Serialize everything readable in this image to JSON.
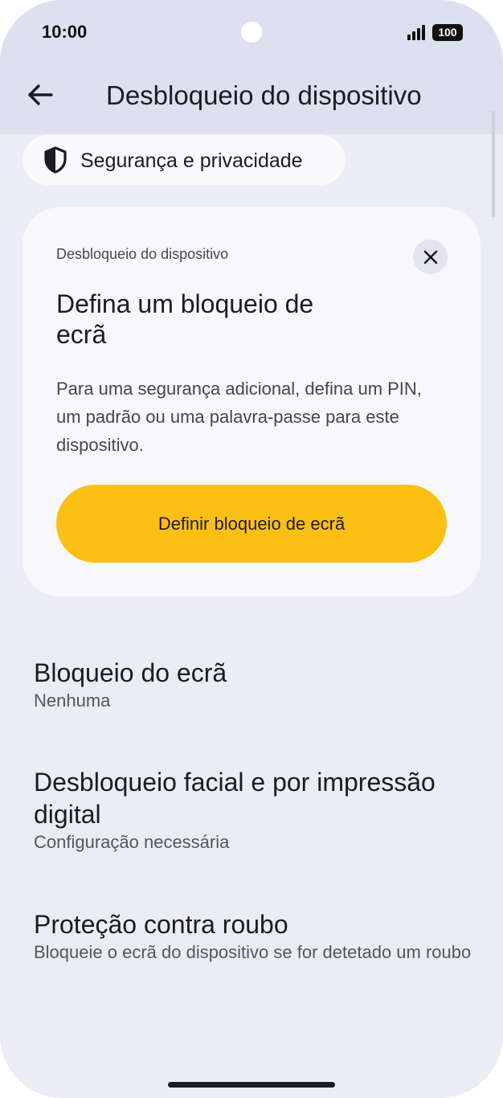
{
  "status_bar": {
    "time": "10:00",
    "battery": "100"
  },
  "app_bar": {
    "title": "Desbloqueio do dispositivo",
    "back_icon": "arrow-left-icon"
  },
  "breadcrumb_chip": {
    "label": "Segurança e privacidade",
    "icon": "shield-icon"
  },
  "card": {
    "overline": "Desbloqueio do dispositivo",
    "title": "Defina um bloqueio de ecrã",
    "description": "Para uma segurança adicional, defina um PIN, um padrão ou uma palavra-passe para este dispositivo.",
    "button_label": "Definir bloqueio de ecrã",
    "close_icon": "close-icon",
    "button_color": "#fcbf14"
  },
  "settings": [
    {
      "title": "Bloqueio do ecrã",
      "subtitle": "Nenhuma"
    },
    {
      "title": "Desbloqueio facial e por impressão digital",
      "subtitle": "Configuração necessária"
    },
    {
      "title": "Proteção contra roubo",
      "subtitle": "Bloqueie o ecrã do dispositivo se for detetado um roubo"
    }
  ],
  "colors": {
    "background": "#ececf7",
    "app_bar": "#dde1ef",
    "card": "#f7f7fc",
    "accent": "#fcbf14"
  }
}
